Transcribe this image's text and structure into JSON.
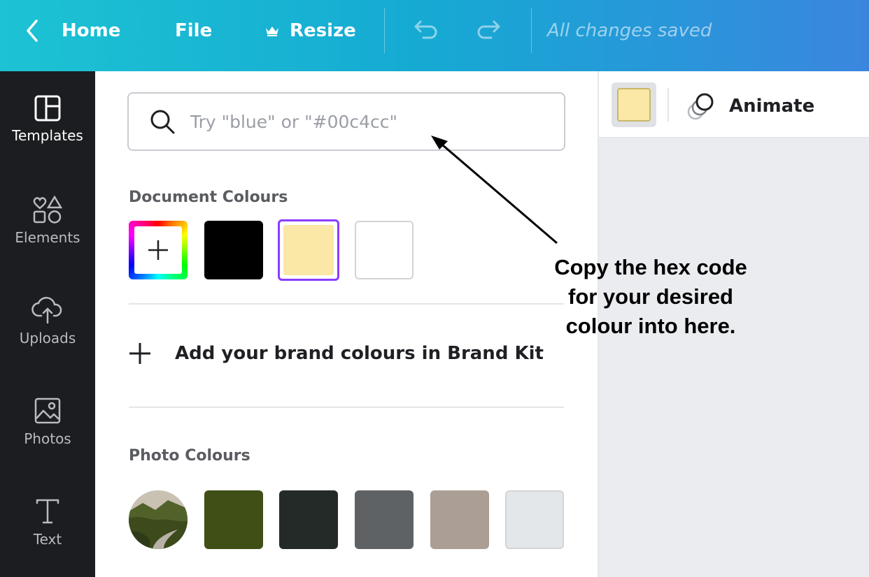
{
  "topbar": {
    "home_label": "Home",
    "file_label": "File",
    "resize_label": "Resize",
    "status_text": "All changes saved"
  },
  "rail": {
    "items": [
      {
        "label": "Templates",
        "icon": "templates-icon"
      },
      {
        "label": "Elements",
        "icon": "elements-icon"
      },
      {
        "label": "Uploads",
        "icon": "upload-cloud-icon"
      },
      {
        "label": "Photos",
        "icon": "photo-icon"
      },
      {
        "label": "Text",
        "icon": "text-icon"
      }
    ]
  },
  "search": {
    "placeholder": "Try \"blue\" or \"#00c4cc\""
  },
  "document_colours": {
    "title": "Document Colours",
    "swatches": [
      "#000000",
      "#fbe8a6",
      "#ffffff"
    ]
  },
  "brand_kit": {
    "label": "Add your brand colours in Brand Kit"
  },
  "photo_colours": {
    "title": "Photo Colours",
    "swatches": [
      "#3f4f15",
      "#232a28",
      "#5e6265",
      "#ab9e94",
      "#e4e7ea"
    ]
  },
  "toolbar": {
    "current_colour": "#fbe8a6",
    "animate_label": "Animate"
  },
  "annotation": {
    "line1": "Copy the hex code",
    "line2": "for your desired",
    "line3": "colour into here."
  }
}
